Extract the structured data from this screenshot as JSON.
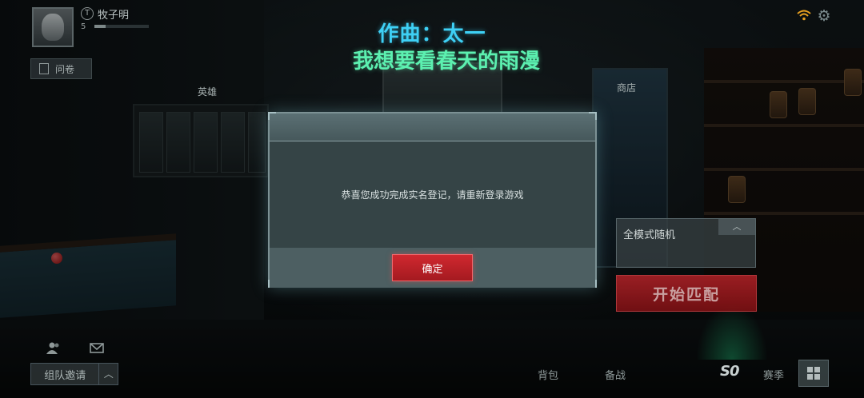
{
  "player": {
    "name": "牧子明",
    "rank_glyph": "T",
    "level": "5",
    "xp_fraction": 0.2
  },
  "survey": {
    "label": "问卷"
  },
  "areas": {
    "hero": "英雄",
    "shop": "商店"
  },
  "song": {
    "composer": "作曲：太一",
    "title": "我想要看春天的雨漫"
  },
  "mode": {
    "label": "全模式随机",
    "chevron": "︿"
  },
  "start": {
    "label": "开始匹配"
  },
  "team": {
    "invite_label": "组队邀请",
    "arrow": "︿"
  },
  "bottom_tabs": {
    "backpack": "背包",
    "loadout": "备战",
    "season_logo": "S0",
    "season": "赛季"
  },
  "modal": {
    "message": "恭喜您成功完成实名登记，请重新登录游戏",
    "confirm": "确定"
  },
  "colors": {
    "accent_cyan": "#3ed0f5",
    "accent_green": "#5cf0b0",
    "button_red": "#c2242a",
    "wifi_orange": "#e8a020"
  },
  "icons": {
    "avatar": "avatar-icon",
    "survey": "clipboard-icon",
    "wifi": "wifi-icon",
    "settings": "gear-icon",
    "friends": "people-icon",
    "mail": "mail-icon",
    "grid": "grid-icon"
  }
}
